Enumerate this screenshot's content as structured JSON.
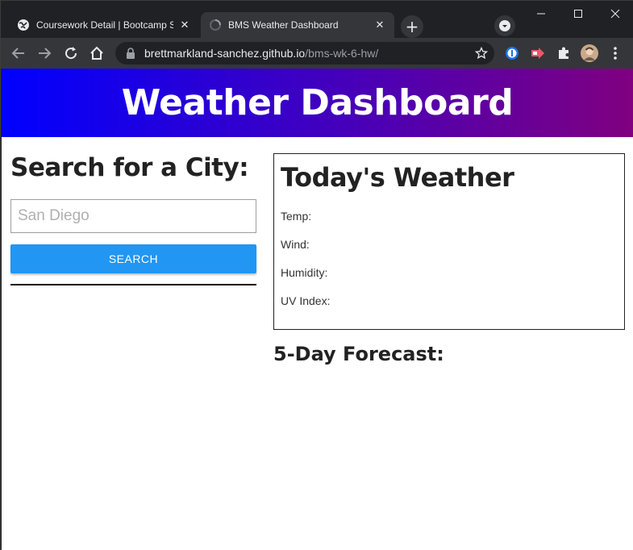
{
  "browser": {
    "tabs": [
      {
        "title": "Coursework Detail | Bootcamp Sp",
        "favicon": "globe-icon",
        "active": false
      },
      {
        "title": "BMS Weather Dashboard",
        "favicon": "loading-icon",
        "active": true
      }
    ],
    "url_host": "brettmarkland-sanchez.github.io",
    "url_path": "/bms-wk-6-hw/"
  },
  "page": {
    "header_title": "Weather Dashboard",
    "search": {
      "heading": "Search for a City:",
      "placeholder": "San Diego",
      "button_label": "SEARCH"
    },
    "today": {
      "heading": "Today's Weather",
      "temp_label": "Temp:",
      "wind_label": "Wind:",
      "humidity_label": "Humidity:",
      "uv_label": "UV Index:"
    },
    "forecast_heading": "5-Day Forecast:"
  },
  "colors": {
    "header_gradient_start": "#0000ff",
    "header_gradient_end": "#800080",
    "search_button": "#2196f3"
  }
}
